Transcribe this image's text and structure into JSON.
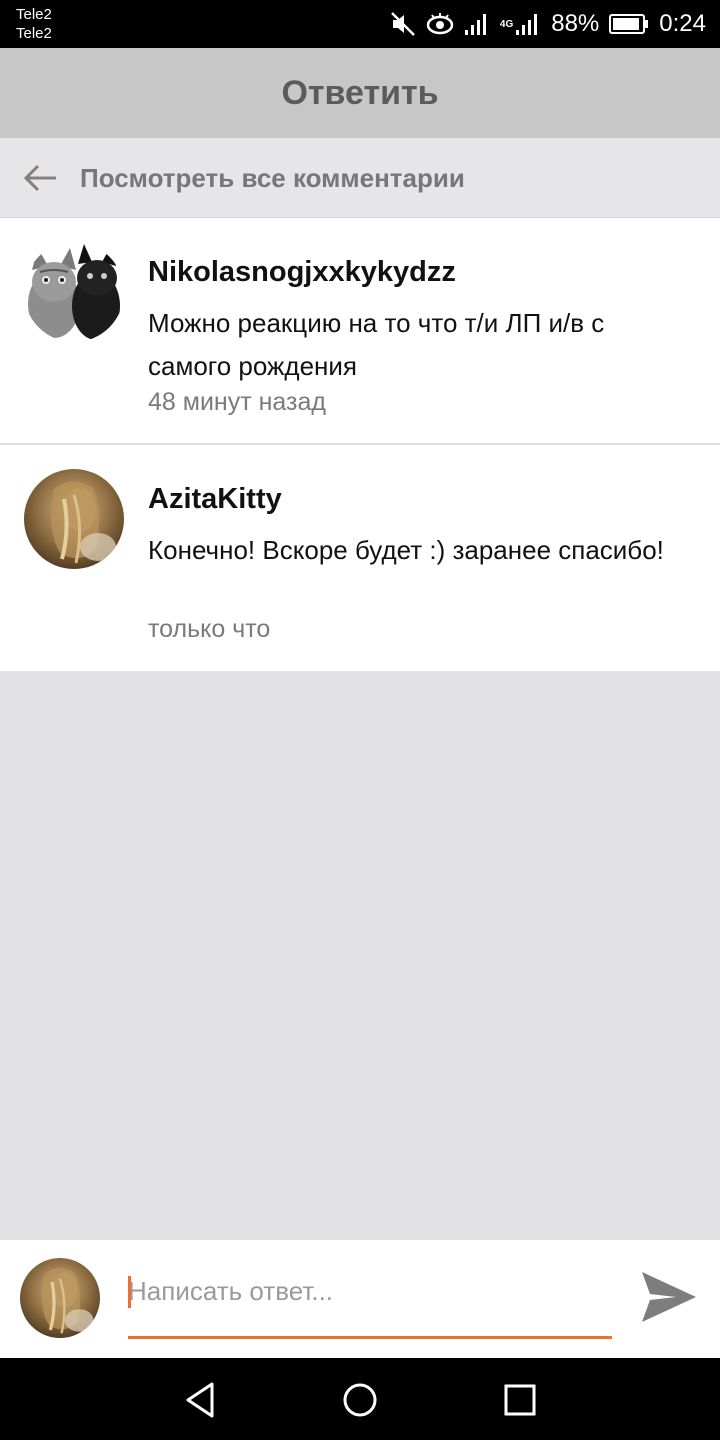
{
  "status_bar": {
    "carrier_1": "Tele2",
    "carrier_2": "Tele2",
    "network": "4G",
    "battery": "88%",
    "time": "0:24"
  },
  "header": {
    "title": "Ответить"
  },
  "view_all": {
    "label": "Посмотреть все комментарии"
  },
  "comments": [
    {
      "author": "Nikolasnogjxxkykydzz",
      "text": "Можно реакцию на то что т/и ЛП и/в с самого рождения",
      "time": "48 минут назад"
    },
    {
      "author": "AzitaKitty",
      "text": "Конечно! Вскоре будет :) заранее спасибо!",
      "time": "только что"
    }
  ],
  "reply": {
    "placeholder": "Написать ответ..."
  },
  "colors": {
    "accent": "#ee7030",
    "header_bg": "#c7c7c7",
    "page_bg": "#e2e1e4"
  },
  "icons": [
    "mute-icon",
    "eye-icon",
    "signal-icon",
    "battery-icon",
    "back-arrow-icon",
    "send-icon",
    "nav-back-icon",
    "nav-home-icon",
    "nav-recents-icon"
  ]
}
